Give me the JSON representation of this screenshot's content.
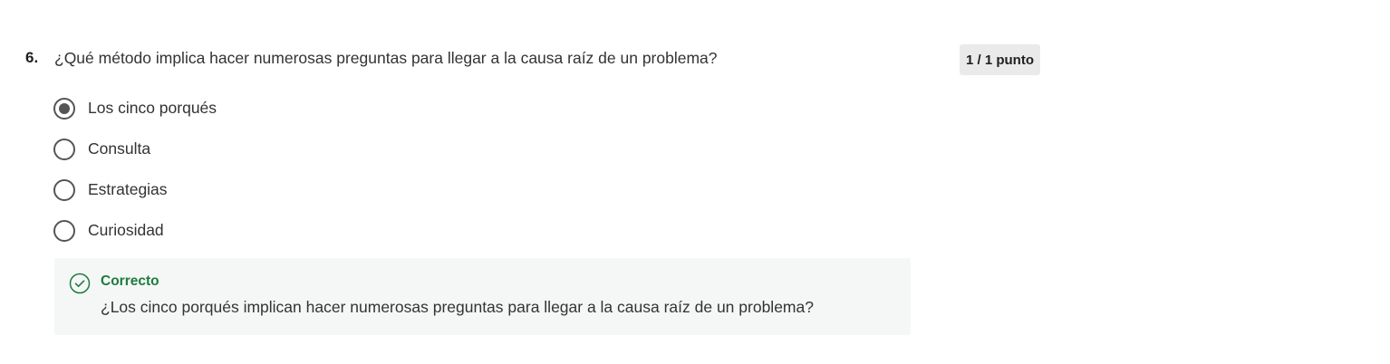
{
  "question": {
    "number": "6.",
    "text": "¿Qué método implica hacer numerosas preguntas para llegar a la causa raíz de un problema?",
    "score": "1 / 1 punto"
  },
  "options": [
    {
      "label": "Los cinco porqués",
      "selected": true
    },
    {
      "label": "Consulta",
      "selected": false
    },
    {
      "label": "Estrategias",
      "selected": false
    },
    {
      "label": "Curiosidad",
      "selected": false
    }
  ],
  "feedback": {
    "icon": "check-circle-icon",
    "status": "Correcto",
    "text": "¿Los cinco porqués implican hacer numerosas preguntas para llegar a la causa raíz de un problema?",
    "status_color": "#1e7a3f"
  }
}
